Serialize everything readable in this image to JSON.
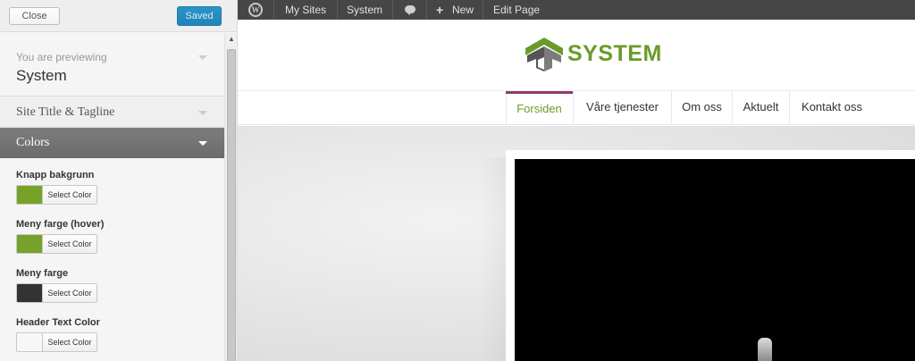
{
  "sidebar": {
    "close_label": "Close",
    "saved_label": "Saved",
    "preview_label": "You are previewing",
    "preview_name": "System",
    "sections": {
      "site_title": "Site Title & Tagline",
      "colors": "Colors"
    },
    "color_controls": [
      {
        "label": "Knapp bakgrunn",
        "button": "Select Color",
        "color": "#76a229"
      },
      {
        "label": "Meny farge (hover)",
        "button": "Select Color",
        "color": "#76a229"
      },
      {
        "label": "Meny farge",
        "button": "Select Color",
        "color": "#333333"
      },
      {
        "label": "Header Text Color",
        "button": "Select Color",
        "color": "#f7f7f7"
      }
    ]
  },
  "adminbar": {
    "items": [
      "My Sites",
      "System",
      "New",
      "Edit Page"
    ],
    "icons": [
      "wordpress-icon",
      "comments-icon",
      "plus-icon"
    ]
  },
  "site": {
    "brand": "SYSTEM",
    "brand_color": "#6a9b2a",
    "nav": [
      "Forsiden",
      "Våre tjenester",
      "Om oss",
      "Aktuelt",
      "Kontakt oss"
    ],
    "nav_active_color": "#8e3a6a"
  }
}
